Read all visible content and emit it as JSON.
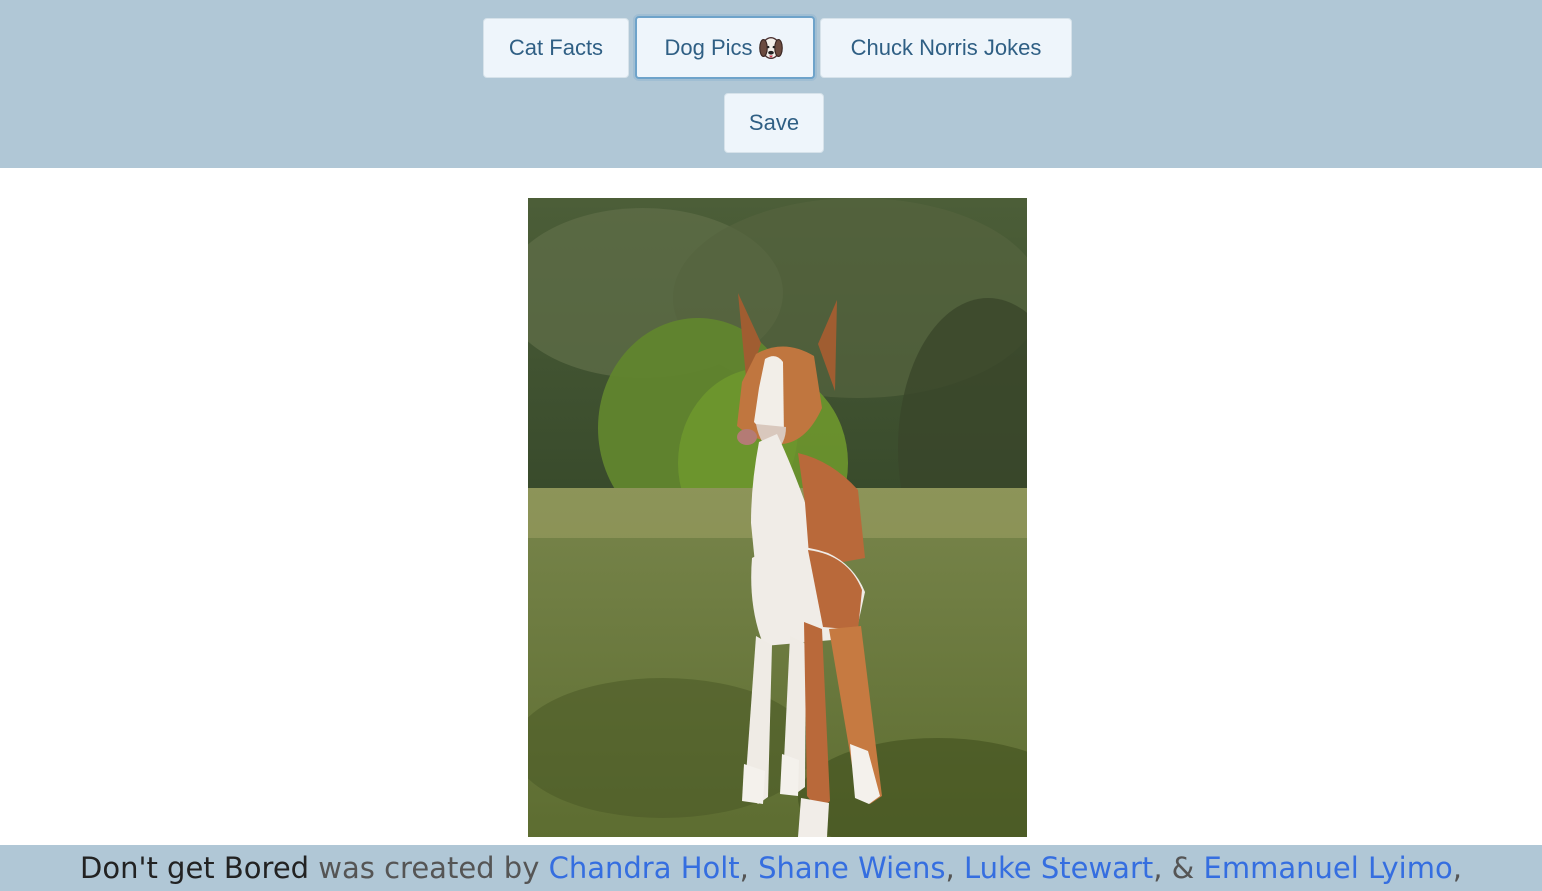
{
  "nav": {
    "cat_facts_label": "Cat Facts",
    "dog_pics_label": "Dog Pics",
    "chuck_norris_label": "Chuck Norris Jokes",
    "save_label": "Save"
  },
  "icons": {
    "dog_pics": "dog-face-icon"
  },
  "footer": {
    "brand": "Don't get Bored",
    "created_by": "was created by",
    "authors": [
      "Chandra Holt",
      "Shane Wiens",
      "Luke Stewart",
      "Emmanuel Lyimo"
    ],
    "separator_comma": ",",
    "separator_and": ", &",
    "trailing": ","
  },
  "colors": {
    "header_bg": "#b0c7d6",
    "button_bg": "#eef5fb",
    "button_text": "#2f5f84",
    "link": "#356ee0"
  }
}
